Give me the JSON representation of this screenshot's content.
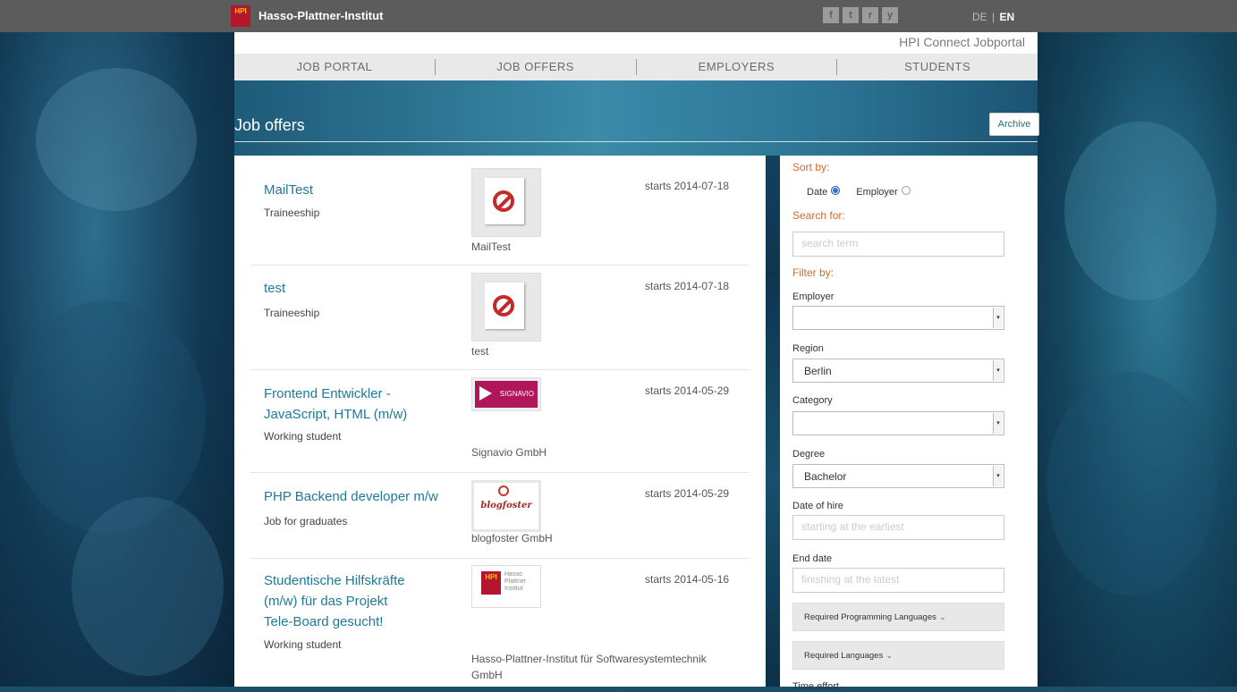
{
  "header": {
    "logo_text": "HPI",
    "site_name": "Hasso-Plattner-Institut",
    "social": {
      "facebook": "f",
      "twitter": "t",
      "rss": "r",
      "youtube": "y"
    },
    "lang": {
      "de": "DE",
      "separator": "|",
      "en": "EN"
    },
    "portal_title": "HPI Connect Jobportal"
  },
  "nav": {
    "items": [
      "JOB PORTAL",
      "JOB OFFERS",
      "EMPLOYERS",
      "STUDENTS"
    ]
  },
  "page": {
    "title": "Job offers",
    "archive_label": "Archive"
  },
  "jobs": [
    {
      "title": "MailTest",
      "type": "Traineeship",
      "employer": "MailTest",
      "starts": "starts 2014-07-18",
      "logo": "no-image-icon"
    },
    {
      "title": "test",
      "type": "Traineeship",
      "employer": "test",
      "starts": "starts 2014-07-18",
      "logo": "no-image-icon"
    },
    {
      "title": "Frontend Entwickler - JavaScript, HTML (m/w)",
      "type": "Working student",
      "employer": "Signavio GmbH",
      "starts": "starts 2014-05-29",
      "logo_text": "SIGNAVIO"
    },
    {
      "title": "PHP Backend developer m/w",
      "type": "Job for graduates",
      "employer": "blogfoster GmbH",
      "starts": "starts 2014-05-29",
      "logo_text": "blogfoster"
    },
    {
      "title": "Studentische Hilfskräfte (m/w) für das Projekt Tele-Board gesucht!",
      "type": "Working student",
      "employer": "Hasso-Plattner-Institut für Softwaresystemtechnik GmbH",
      "starts": "starts 2014-05-16",
      "logo_text": "HPI",
      "logo_sub": "Hasso Plattner Institut"
    }
  ],
  "sidebar": {
    "sort_label": "Sort by:",
    "sort_date": "Date",
    "sort_employer": "Employer",
    "search_label": "Search for:",
    "search_placeholder": "search term",
    "filter_label": "Filter by:",
    "employer_label": "Employer",
    "employer_value": "",
    "region_label": "Region",
    "region_value": "Berlin",
    "category_label": "Category",
    "category_value": "",
    "degree_label": "Degree",
    "degree_value": "Bachelor",
    "hire_label": "Date of hire",
    "hire_placeholder": "starting at the earliest",
    "end_label": "End date",
    "end_placeholder": "finishing at the latest",
    "prog_lang_label": "Required Programming Languages",
    "lang_label": "Required Languages",
    "time_effort_label": "Time effort"
  },
  "colors": {
    "accent_link": "#1d7a99",
    "orange_label": "#d06a2e",
    "topbar": "#5c5c5c"
  }
}
